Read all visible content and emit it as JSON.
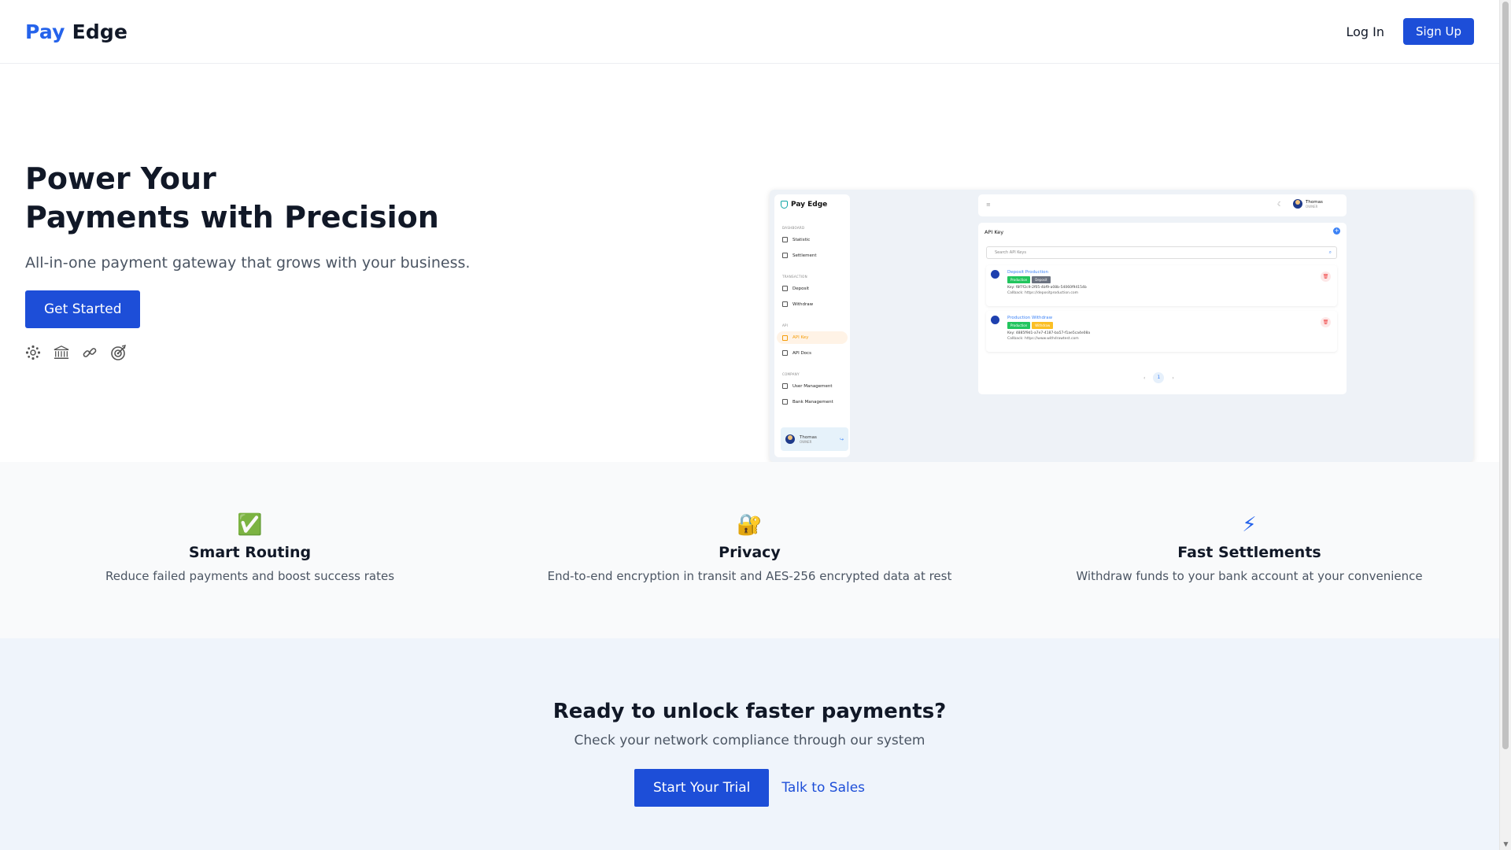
{
  "header": {
    "logo_pay": "Pay",
    "logo_edge": "Edge",
    "login_label": "Log In",
    "signup_label": "Sign Up"
  },
  "hero": {
    "title_line1": "Power Your",
    "title_line2": "Payments with Precision",
    "subtitle": "All-in-one payment gateway that grows with your business.",
    "cta_label": "Get Started",
    "partner_icons": [
      "network-icon",
      "bank-icon",
      "chain-link-icon",
      "target-icon"
    ]
  },
  "preview": {
    "brand": "Pay Edge",
    "sections": {
      "dashboard": "DASHBOARD",
      "transaction": "TRANSACTION",
      "api": "API",
      "company": "COMPANY"
    },
    "menu": {
      "statistic": "Statistic",
      "settlement": "Settlement",
      "deposit": "Deposit",
      "withdraw": "Withdraw",
      "api_key": "API Key",
      "api_docs": "API Docs",
      "user_management": "User Management",
      "bank_management": "Bank Management"
    },
    "user": {
      "name": "Thomas",
      "role": "OWNER"
    },
    "card_title": "API Key",
    "search_placeholder": "Search API Keys",
    "keys": [
      {
        "name": "Deposit Production",
        "tags": [
          "Production",
          "Deposit"
        ],
        "key": "Key: f8f7f2c9-2f05-4bf9-a08b-54060f94154b",
        "callback": "Callback: https://depositproduction.com"
      },
      {
        "name": "Production Withdraw",
        "tags": [
          "Production",
          "Withdraw"
        ],
        "key": "Key: 4885f9d1-a7e7-4187-ba57-f1ae5ca4e08a",
        "callback": "Callback: https://www.withdrawtest.com"
      }
    ],
    "pagination": {
      "prev": "‹",
      "current": "1",
      "next": "›"
    }
  },
  "features": [
    {
      "icon": "✅",
      "title": "Smart Routing",
      "desc": "Reduce failed payments and boost success rates"
    },
    {
      "icon": "🔐",
      "title": "Privacy",
      "desc": "End-to-end encryption in transit and AES-256 encrypted data at rest"
    },
    {
      "icon": "⚡",
      "title": "Fast Settlements",
      "desc": "Withdraw funds to your bank account at your convenience"
    }
  ],
  "cta": {
    "title": "Ready to unlock faster payments?",
    "subtitle": "Check your network compliance through our system",
    "trial_label": "Start Your Trial",
    "sales_label": "Talk to Sales"
  },
  "colors": {
    "brand_blue": "#1d4ed8",
    "logo_blue": "#2563eb",
    "feature_bg": "#f9fafb",
    "cta_bg": "#eff4fb"
  }
}
